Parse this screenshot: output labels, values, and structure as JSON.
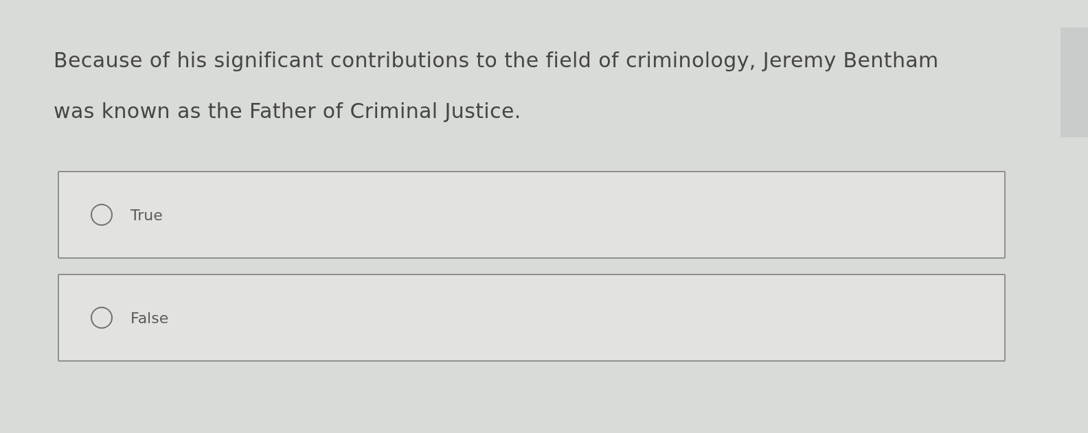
{
  "question": {
    "text": "Because of his significant contributions to the field of criminology, Jeremy Bentham was known as the Father of Criminal Justice."
  },
  "options": [
    {
      "label": "True",
      "selected": false
    },
    {
      "label": "False",
      "selected": false
    }
  ]
}
